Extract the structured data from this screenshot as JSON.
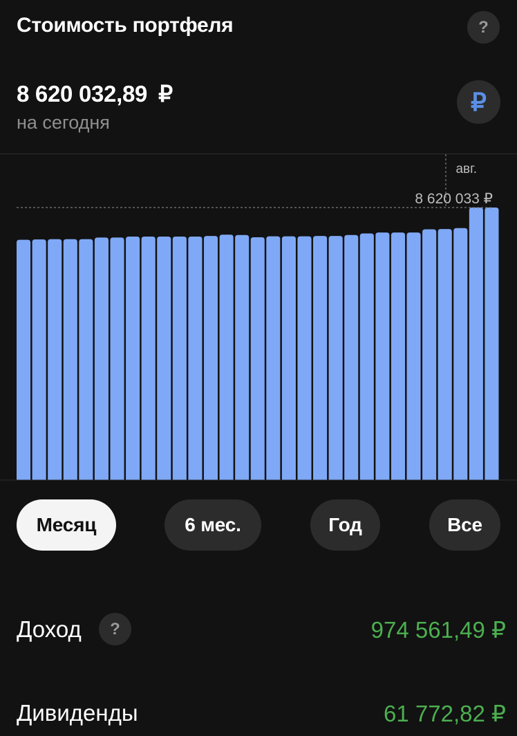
{
  "header": {
    "title": "Стоимость портфеля",
    "help_icon": "question-icon"
  },
  "summary": {
    "value": "8 620 032,89",
    "currency_symbol": "₽",
    "subtitle": "на сегодня",
    "currency_button": "₽"
  },
  "chart_data": {
    "type": "bar",
    "month_label": "авг.",
    "max_label": "8 620 033 ₽",
    "values": [
      7600000,
      7610000,
      7620000,
      7620000,
      7620000,
      7670000,
      7670000,
      7700000,
      7700000,
      7700000,
      7700000,
      7700000,
      7720000,
      7760000,
      7750000,
      7680000,
      7710000,
      7710000,
      7710000,
      7720000,
      7720000,
      7750000,
      7800000,
      7830000,
      7830000,
      7830000,
      7930000,
      7940000,
      7970000,
      8620033,
      8620033
    ],
    "ylim": [
      0,
      8620033
    ],
    "bar_color": "#7fa9f6",
    "grid": false
  },
  "periods": {
    "month": "Месяц",
    "six_months": "6 мес.",
    "year": "Год",
    "all": "Все",
    "active": "Месяц"
  },
  "income": {
    "label": "Доход",
    "value": "974 561,49 ₽"
  },
  "dividends": {
    "label": "Дивиденды",
    "value": "61 772,82 ₽"
  },
  "colors": {
    "background": "#121212",
    "positive": "#4caf50",
    "accent": "#5b8fe6",
    "bar": "#7fa9f6"
  }
}
